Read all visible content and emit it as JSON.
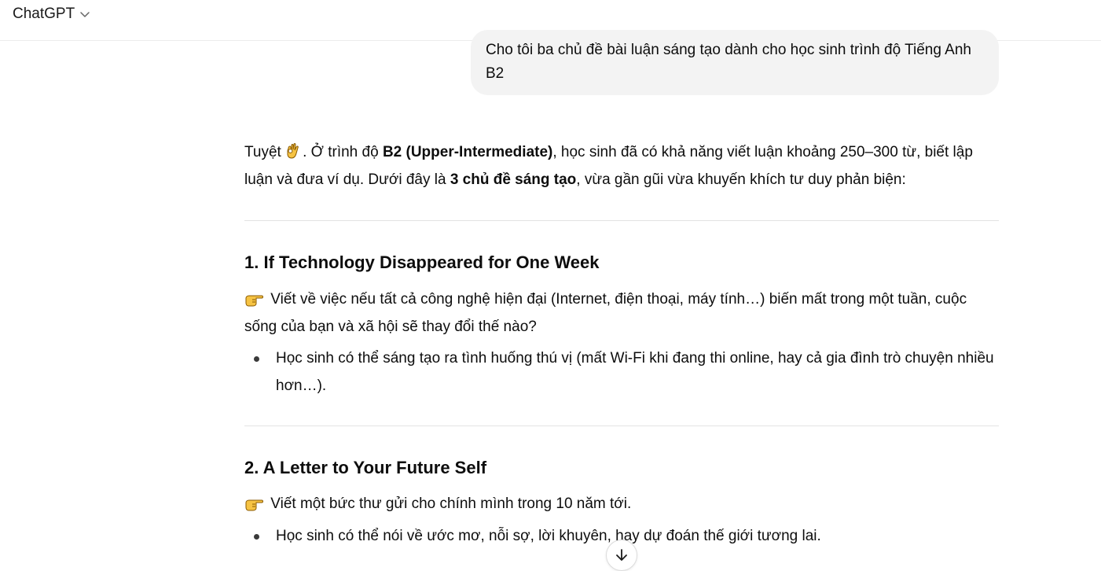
{
  "header": {
    "model_name": "ChatGPT",
    "chevron_icon": "chevron-down-icon"
  },
  "user_message": {
    "text": "Cho tôi ba chủ đề bài luận sáng tạo dành cho học sinh trình độ Tiếng Anh B2"
  },
  "answer": {
    "intro": {
      "part1": "Tuyệt ",
      "emoji_icon": "ok-hand-icon",
      "part2": ". Ở trình độ ",
      "bold1": "B2 (Upper-Intermediate)",
      "part3": ", học sinh đã có khả năng viết luận khoảng 250–300 từ, biết lập luận và đưa ví dụ. Dưới đây là ",
      "bold2": "3 chủ đề sáng tạo",
      "part4": ", vừa gần gũi vừa khuyến khích tư duy phản biện:"
    },
    "topics": [
      {
        "heading": "1. If Technology Disappeared for One Week",
        "pointer_icon": "pointing-hand-icon",
        "description": "Viết về việc nếu tất cả công nghệ hiện đại (Internet, điện thoại, máy tính…) biến mất trong một tuần, cuộc sống của bạn và xã hội sẽ thay đổi thế nào?",
        "bullet": "Học sinh có thể sáng tạo ra tình huống thú vị (mất Wi-Fi khi đang thi online, hay cả gia đình trò chuyện nhiều hơn…)."
      },
      {
        "heading": "2. A Letter to Your Future Self",
        "pointer_icon": "pointing-hand-icon",
        "description": "Viết một bức thư gửi cho chính mình trong 10 năm tới.",
        "bullet": "Học sinh có thể nói về ước mơ, nỗi sợ, lời khuyên, hay dự đoán thế giới tương lai."
      }
    ]
  },
  "scroll_button": {
    "icon": "arrow-down-icon"
  }
}
